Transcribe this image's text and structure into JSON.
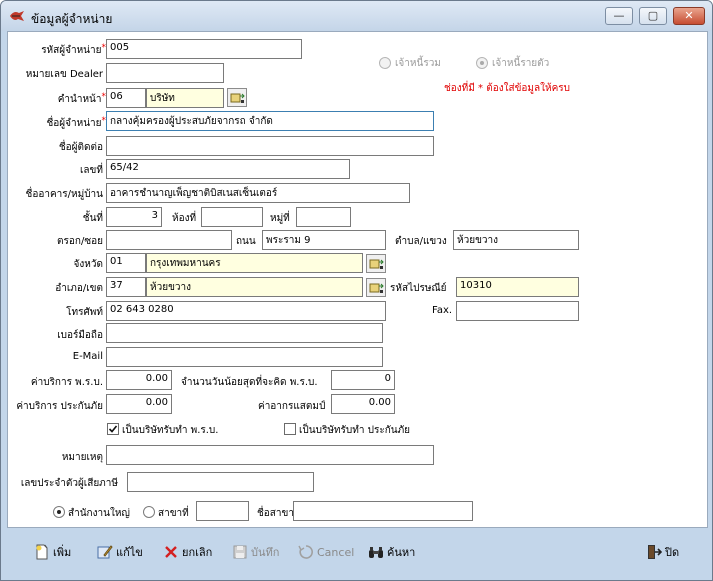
{
  "window": {
    "title": "ข้อมูลผู้จำหน่าย",
    "minimize": "—",
    "maximize": "▢",
    "close": "✕"
  },
  "form": {
    "supplier_code": {
      "label": "รหัสผู้จำหน่าย",
      "value": "005"
    },
    "dealer_no": {
      "label": "หมายเลข Dealer",
      "value": ""
    },
    "prefix": {
      "label": "คำนำหน้า",
      "code": "06",
      "name": "บริษัท"
    },
    "supplier_name": {
      "label": "ชื่อผู้จำหน่าย",
      "value": "กลางคุ้มครองผู้ประสบภัยจากรถ จำกัด"
    },
    "contact_name": {
      "label": "ชื่อผู้ติดต่อ",
      "value": ""
    },
    "house_no": {
      "label": "เลขที่",
      "value": "65/42"
    },
    "building": {
      "label": "ชื่ออาคาร/หมู่บ้าน",
      "value": "อาคารชำนาญเพ็ญชาติบิสเนสเซ็นเตอร์"
    },
    "floor": {
      "label": "ชั้นที่",
      "value": "3"
    },
    "room": {
      "label": "ห้องที่",
      "value": ""
    },
    "moo": {
      "label": "หมู่ที่",
      "value": ""
    },
    "soi": {
      "label": "ตรอก/ซอย",
      "value": ""
    },
    "road": {
      "label": "ถนน",
      "value": "พระราม 9"
    },
    "subdistrict": {
      "label": "ตำบล/แขวง",
      "value": "ห้วยขวาง"
    },
    "province": {
      "label": "จังหวัด",
      "code": "01",
      "name": "กรุงเทพมหานคร"
    },
    "district": {
      "label": "อำเภอ/เขต",
      "code": "37",
      "name": "ห้วยขวาง"
    },
    "postcode": {
      "label": "รหัสไปรษณีย์",
      "value": "10310"
    },
    "phone": {
      "label": "โทรศัพท์",
      "value": "02 643 0280"
    },
    "fax": {
      "label": "Fax.",
      "value": ""
    },
    "mobile": {
      "label": "เบอร์มือถือ",
      "value": ""
    },
    "email": {
      "label": "E-Mail",
      "value": ""
    },
    "fee_prb": {
      "label": "ค่าบริการ พ.ร.บ.",
      "value": "0.00"
    },
    "min_days_prb": {
      "label": "จำนวนวันน้อยสุดที่จะคิด พ.ร.บ.",
      "value": "0"
    },
    "fee_insurance": {
      "label": "ค่าบริการ ประกันภัย",
      "value": "0.00"
    },
    "stamp_duty": {
      "label": "ค่าอากรแสตมป์",
      "value": "0.00"
    },
    "is_prb_company": {
      "label": "เป็นบริษัทรับทำ พ.ร.บ.",
      "checked": true
    },
    "is_insurance_company": {
      "label": "เป็นบริษัทรับทำ ประกันภัย",
      "checked": false
    },
    "remark": {
      "label": "หมายเหตุ",
      "value": ""
    },
    "tax_id": {
      "label": "เลขประจำตัวผู้เสียภาษี",
      "value": ""
    },
    "branch_type": {
      "head_office": "สำนักงานใหญ่",
      "branch": "สาขาที่",
      "selected": "head_office"
    },
    "branch_no": {
      "value": ""
    },
    "branch_name": {
      "label": "ชื่อสาขา",
      "value": ""
    }
  },
  "creditor_type": {
    "combined": "เจ้าหนี้รวม",
    "individual": "เจ้าหนี้รายตัว",
    "selected": "individual",
    "enabled": false
  },
  "notice": "ช่องที่มี * ต้องใส่ข้อมูลให้ครบ",
  "required_mark": "*",
  "toolbar": {
    "add": "เพิ่ม",
    "edit": "แก้ไข",
    "cancel_record": "ยกเลิก",
    "save": "บันทึก",
    "cancel": "Cancel",
    "search": "ค้นหา",
    "close": "ปิด"
  },
  "colors": {
    "window_frame": "#c3d6ea",
    "required": "#e00000",
    "lookup_field": "#ffffe0",
    "focus_border": "#3c7fb1"
  },
  "icons": [
    "supplier-app-icon",
    "lookup-icon",
    "add-doc-icon",
    "edit-icon",
    "delete-x-icon",
    "save-disk-icon",
    "cancel-icon",
    "binoculars-icon",
    "exit-door-icon"
  ]
}
